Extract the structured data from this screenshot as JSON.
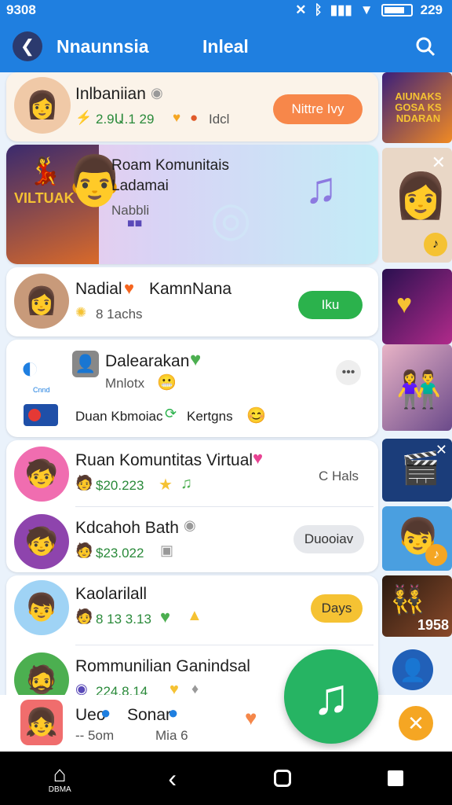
{
  "status_bar": {
    "time": "9308",
    "clock": "229"
  },
  "app_bar": {
    "title": "Nnaunnsia",
    "subtitle": "Inleal"
  },
  "feed": {
    "card1": {
      "name": "Inlbaniian",
      "stats": "2.9Ա.1 29",
      "stats2": "Idcl",
      "button": "Nittre Ivy"
    },
    "banner": {
      "title": "Roam Komunitais",
      "subtitle": "Ladamai",
      "tag": "Nabbli",
      "poster_text": "VILTUAK"
    },
    "card2": {
      "name": "Nadial",
      "name2": "KamnNana",
      "stats": "8 1achs",
      "button": "Iku"
    },
    "card3": {
      "name": "Dalearakan",
      "sub": "Mnlotx",
      "footer": "Duan Kbmoiac",
      "footer2": "Kertgns",
      "logo_text": "Cnnd"
    },
    "card4": {
      "name": "Ruan Komuntitas Virtual",
      "stats": "$20.223",
      "side": "C Hals"
    },
    "card5": {
      "name": "Kdcahoh Bath",
      "stats": "$23.022",
      "button": "Duooiav"
    },
    "card6": {
      "name": "Kaolarilall",
      "stats": "8 13 3.13",
      "button": "Days"
    },
    "card7": {
      "name": "Rommunilian Ganindsal",
      "stats": "224.8.14"
    }
  },
  "side": {
    "promo_text": "AIUNAKS GOSA KS NDARAN",
    "badge": "1958"
  },
  "player": {
    "title": "Ueo",
    "title2": "Sonar",
    "time": "-- 5om",
    "time2": "Mia 6"
  },
  "navbar": {
    "home_label": "DBMA"
  },
  "colors": {
    "accent": "#1f7fe0",
    "orange": "#f7874a",
    "green": "#26b463",
    "yellow": "#f5c233"
  }
}
